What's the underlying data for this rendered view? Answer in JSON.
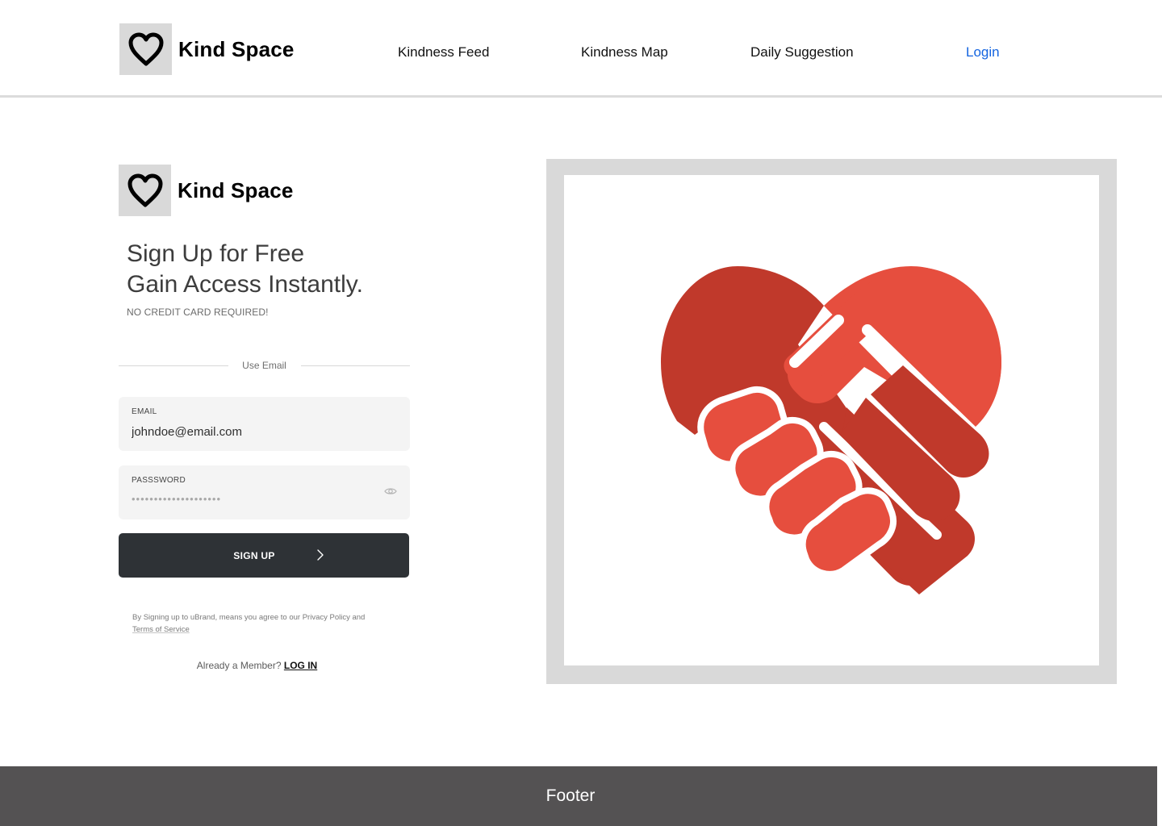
{
  "brand": {
    "name": "Kind Space"
  },
  "nav": {
    "links": [
      "Kindness Feed",
      "Kindness Map",
      "Daily Suggestion"
    ],
    "login": "Login"
  },
  "signup": {
    "headline_line1": "Sign Up for Free",
    "headline_line2": "Gain Access Instantly.",
    "subtext": "NO CREDIT CARD REQUIRED!",
    "divider_label": "Use Email",
    "email": {
      "label": "EMAIL",
      "value": "johndoe@email.com"
    },
    "password": {
      "label": "PASSSWORD",
      "masked": "••••••••••••••••••••"
    },
    "button_label": "SIGN UP",
    "terms_prefix": "By Signing up to uBrand, means you agree to our Privacy Policy and",
    "terms_link": "Terms of Service",
    "member_prompt": "Already a Member?",
    "login_link": "LOG IN"
  },
  "hero": {
    "icon": "heart-handshake-icon",
    "colors": {
      "dark_red": "#c0392b",
      "light_red": "#e64e3e"
    }
  },
  "footer": {
    "text": "Footer"
  },
  "colors": {
    "login_blue": "#1565e0",
    "button_dark": "#2e3236",
    "footer_bg": "#545253",
    "frame_grey": "#d9d9d9"
  }
}
